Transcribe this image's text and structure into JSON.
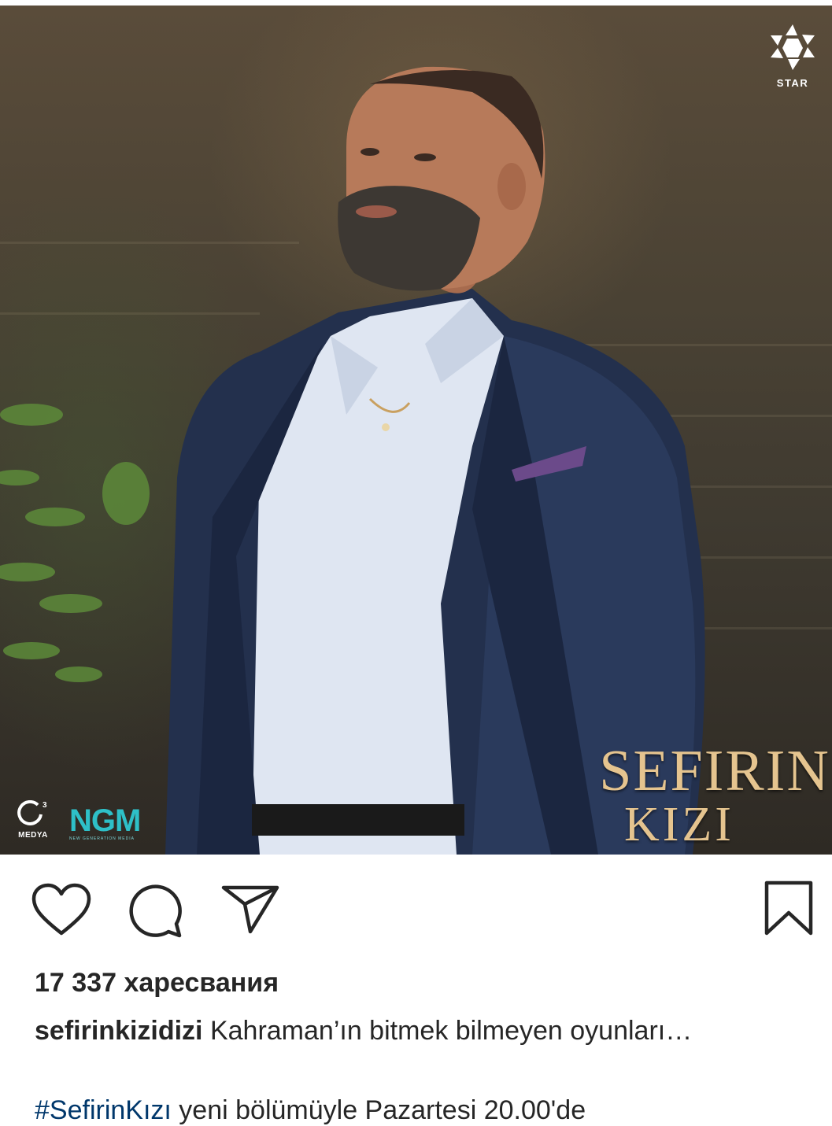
{
  "post": {
    "image": {
      "watermark_top": "STAR",
      "show_title_line1": "SEFIRIN",
      "show_title_line2": "KIZI",
      "producer_left": "MEDYA",
      "producer_right": "NGM",
      "producer_right_sub": "NEW GENERATION MEDIA"
    },
    "actions": {
      "like_icon": "heart-icon",
      "comment_icon": "comment-icon",
      "share_icon": "paper-plane-icon",
      "save_icon": "bookmark-icon"
    },
    "likes_text": "17 337 харесвания",
    "caption": {
      "username": "sefirinkizidizi",
      "text": "Kahraman’ın bitmek bilmeyen oyunları…"
    },
    "next_line": {
      "hashtag": "#SefirinKızı",
      "text": " yeni bölümüyle Pazartesi 20.00'de"
    }
  },
  "colors": {
    "text": "#262626",
    "link": "#00376b",
    "logo_gold": "#e5c48f",
    "ngm_teal": "#2ec0c8"
  }
}
